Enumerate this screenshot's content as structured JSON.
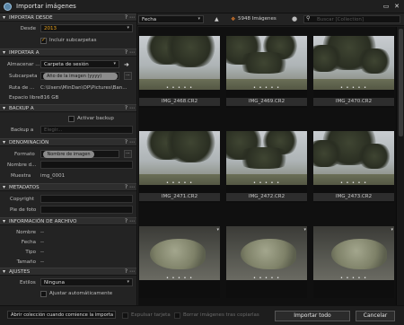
{
  "window": {
    "title": "Importar imágenes",
    "pin_icon": "pin-icon",
    "close_icon": "close-icon"
  },
  "left": {
    "importar_desde": {
      "title": "IMPORTAR DESDE",
      "desde_label": "Desde",
      "desde_value": "2013",
      "include_sub": "Incluir subcarpetas",
      "include_sub_checked": true
    },
    "importar_a": {
      "title": "IMPORTAR A",
      "almacenar_label": "Almacenar ...",
      "almacenar_value": "Carpeta de sesión",
      "subcarpeta_label": "Subcarpeta",
      "subcarpeta_value": "Año de la imagen (yyyy)",
      "ruta_label": "Ruta de ...",
      "ruta_value": "C:\\Users\\MinDan\\OP\\Pictures\\Ban...",
      "espacio_label": "Espacio libre",
      "espacio_value": "816 GB"
    },
    "backup": {
      "title": "BACKUP A",
      "activar": "Activar backup",
      "activar_checked": false,
      "backup_label": "Backup a",
      "backup_placeholder": "Elegir..."
    },
    "denominacion": {
      "title": "DENOMINACIÓN",
      "formato_label": "Formato",
      "formato_value": "Nombre de imagen",
      "nombre_label": "Nombre d...",
      "nombre_value": "",
      "muestra_label": "Muestra",
      "muestra_value": "img_0001"
    },
    "metadatos": {
      "title": "METADATOS",
      "copyright_label": "Copyright",
      "pie_label": "Pie de foto"
    },
    "info": {
      "title": "INFORMACIÓN DE ARCHIVO",
      "nombre": "Nombre",
      "fecha": "Fecha",
      "tipo": "Tipo",
      "tamano": "Tamaño",
      "dash": "--"
    },
    "ajustes": {
      "title": "AJUSTES",
      "estilos_label": "Estilos",
      "estilos_value": "Ninguna",
      "ajustar": "Ajustar automáticamente",
      "ajustar_checked": false
    }
  },
  "toolbar": {
    "sort_value": "Fecha",
    "count": "5948 Imágenes",
    "search_placeholder": "Buscar [Collection]"
  },
  "thumbs": [
    {
      "name": "IMG_2468.CR2",
      "kind": "tree"
    },
    {
      "name": "IMG_2469.CR2",
      "kind": "tree"
    },
    {
      "name": "IMG_2470.CR2",
      "kind": "tree"
    },
    {
      "name": "IMG_2471.CR2",
      "kind": "tree"
    },
    {
      "name": "IMG_2472.CR2",
      "kind": "tree"
    },
    {
      "name": "IMG_2473.CR2",
      "kind": "tree"
    },
    {
      "name": "",
      "kind": "animal"
    },
    {
      "name": "",
      "kind": "animal"
    },
    {
      "name": "",
      "kind": "animal"
    }
  ],
  "bottom": {
    "open_collection": "Abrir colección cuando comience la importa",
    "expulsar": "Expulsar tarjeta",
    "borrar": "Borrar imágenes tras copiarlas",
    "importar": "Importar todo",
    "cancelar": "Cancelar"
  }
}
